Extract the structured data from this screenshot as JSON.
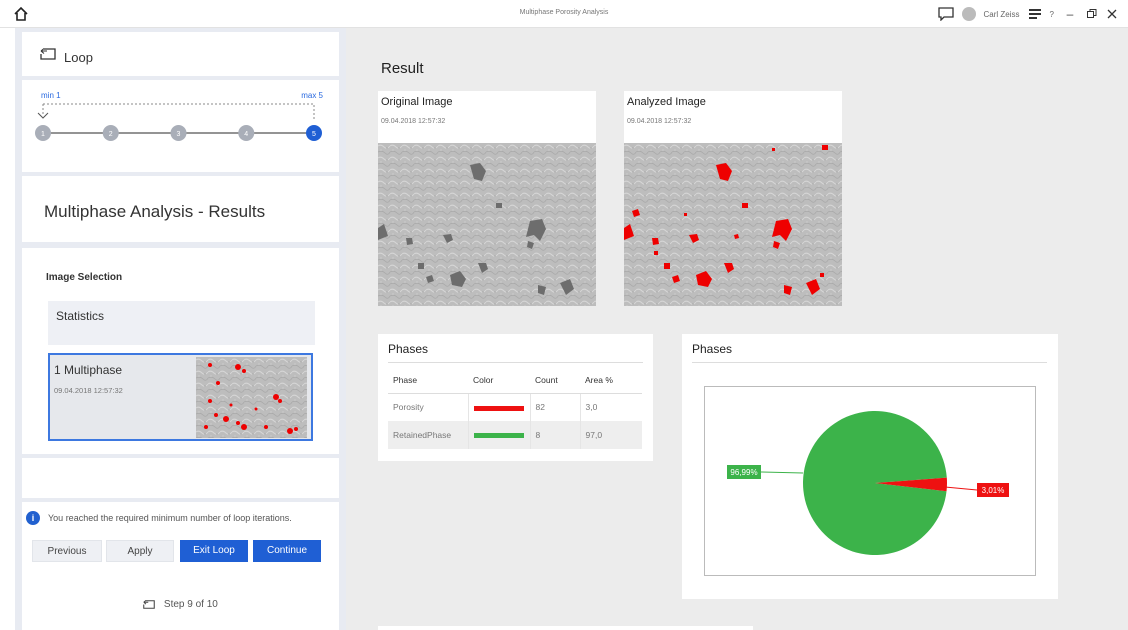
{
  "window": {
    "title": "Multiphase Porosity Analysis",
    "user": "Carl Zeiss",
    "help": "?",
    "home_icon": "home-icon"
  },
  "sidebar": {
    "loop_label": "Loop",
    "stepper": {
      "min_label": "min 1",
      "max_label": "max 5",
      "steps": [
        "1",
        "2",
        "3",
        "4",
        "5"
      ],
      "current": 5
    },
    "section_title": "Multiphase Analysis - Results",
    "image_selection": {
      "heading": "Image Selection",
      "statistics_label": "Statistics",
      "selected_item": {
        "name": "1 Multiphase",
        "date": "09.04.2018 12:57:32"
      }
    },
    "message": "You reached the required minimum number of loop iterations.",
    "buttons": {
      "previous": "Previous",
      "apply": "Apply",
      "exit_loop": "Exit Loop",
      "continue": "Continue"
    },
    "step_text": "Step 9 of 10"
  },
  "main": {
    "title": "Result",
    "original": {
      "name": "Original Image",
      "date": "09.04.2018 12:57:32"
    },
    "analyzed": {
      "name": "Analyzed Image",
      "date": "09.04.2018 12:57:32"
    },
    "phases_table": {
      "title": "Phases",
      "headers": [
        "Phase",
        "Color",
        "Count",
        "Area %"
      ],
      "rows": [
        {
          "phase": "Porosity",
          "color": "#ee1111",
          "count": "82",
          "area": "3,0"
        },
        {
          "phase": "RetainedPhase",
          "color": "#3cb34a",
          "count": "8",
          "area": "97,0"
        }
      ]
    },
    "phases_chart_title": "Phases"
  },
  "chart_data": {
    "type": "pie",
    "title": "Phases",
    "slices": [
      {
        "name": "RetainedPhase",
        "value": 96.99,
        "label": "96,99%",
        "color": "#3cb34a"
      },
      {
        "name": "Porosity",
        "value": 3.01,
        "label": "3,01%",
        "color": "#ee1111"
      }
    ]
  }
}
